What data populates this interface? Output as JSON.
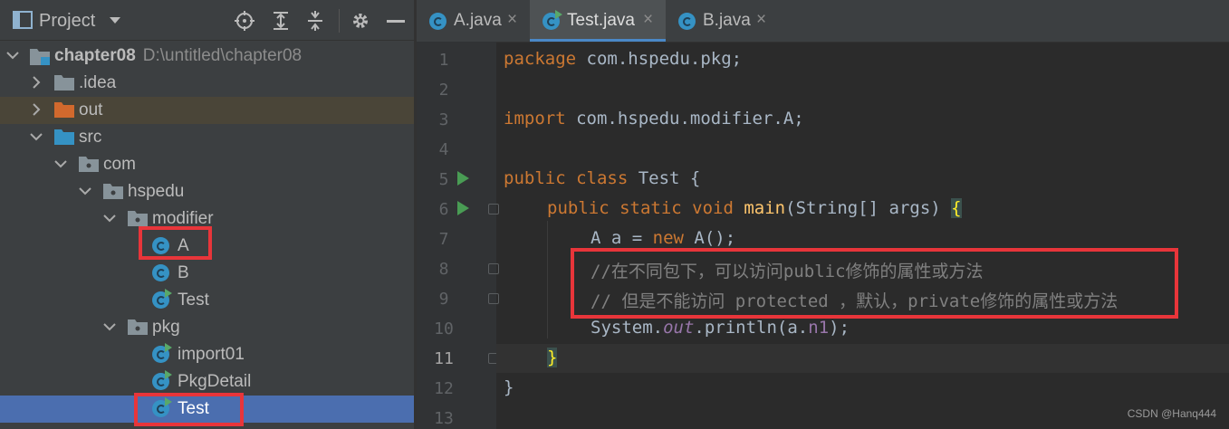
{
  "project_panel": {
    "title": "Project",
    "tree": [
      {
        "label": "chapter08",
        "path": "D:\\untitled\\chapter08"
      },
      {
        "label": ".idea"
      },
      {
        "label": "out"
      },
      {
        "label": "src"
      },
      {
        "label": "com"
      },
      {
        "label": "hspedu"
      },
      {
        "label": "modifier"
      },
      {
        "label": "A"
      },
      {
        "label": "B"
      },
      {
        "label": "Test"
      },
      {
        "label": "pkg"
      },
      {
        "label": "import01"
      },
      {
        "label": "PkgDetail"
      },
      {
        "label": "Test"
      }
    ]
  },
  "tabs": [
    {
      "label": "A.java",
      "close": "×"
    },
    {
      "label": "Test.java",
      "close": "×"
    },
    {
      "label": "B.java",
      "close": "×"
    }
  ],
  "editor": {
    "line_numbers": [
      "1",
      "2",
      "3",
      "4",
      "5",
      "6",
      "7",
      "8",
      "9",
      "10",
      "11",
      "12",
      "13"
    ],
    "lines": {
      "l1": {
        "kw": "package",
        "rest": " com.hspedu.pkg;"
      },
      "l3": {
        "kw": "import",
        "rest": " com.hspedu.modifier.A;"
      },
      "l5": {
        "kw": "public class",
        "rest": " Test {"
      },
      "l6": {
        "kw": "public static void",
        "fn": "main",
        "rest": "(String[] args) ",
        "brace": "{"
      },
      "l7": {
        "pre": "A a = ",
        "kw": "new",
        "rest": " A();"
      },
      "l8": {
        "comment": "//在不同包下，可以访问public修饰的属性或方法"
      },
      "l9": {
        "comment": "// 但是不能访问 protected ，默认，private修饰的属性或方法"
      },
      "l10": {
        "pre": "System.",
        "static": "out",
        "mid": ".println(a.",
        "field": "n1",
        "rest": ");"
      },
      "l11": {
        "brace": "}"
      },
      "l12": {
        "rest": "}"
      }
    }
  },
  "watermark": "CSDN @Hanq444",
  "colors": {
    "highlight_box": "#e8353a",
    "selection": "#4b6eaf",
    "class_icon": "#3592c4"
  }
}
